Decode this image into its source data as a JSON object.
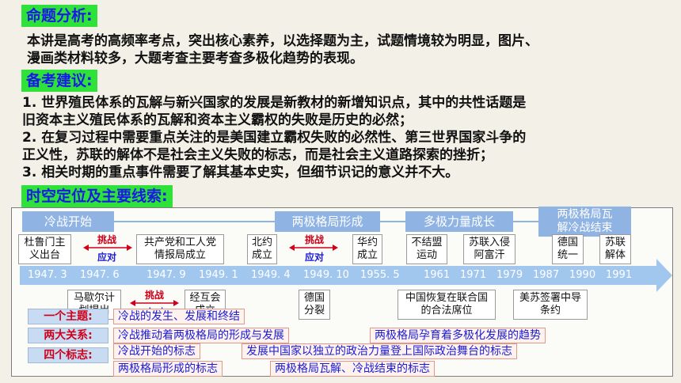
{
  "headings": {
    "analysis": "命题分析:",
    "advice": "备考建议:",
    "timeline": "时空定位及主要线索:"
  },
  "analysis_lines": [
    "本讲是高考的高频率考点，突出核心素养，以选择题为主，试题情境较为明显，图片、",
    "漫画类材料较多，大题考查主要考查多极化趋势的表现。"
  ],
  "advice_lines": [
    "1. 世界殖民体系的瓦解与新兴国家的发展是新教材的新增知识点，其中的共性话题是",
    "旧资本主义殖民体系的瓦解和资本主义霸权的失败是历史的必然；",
    "2. 在复习过程中需要重点关注的是美国建立霸权失败的必然性、第三世界国家斗争的",
    "正义性，苏联的解体不是社会主义失败的标志，而是社会主义道路探索的挫折；",
    "3. 相关时期的重点事件需要了解其基本史实，但细节识记的意义并不大。"
  ],
  "phases": {
    "start": "冷战开始",
    "bipolar": "两极格局形成",
    "multipolar": "多极力量成长",
    "end_line1": "两极格局瓦",
    "end_line2": "解冷战结束"
  },
  "top_events": [
    "杜鲁门主义出台",
    "共产党和工人党情报局成立",
    "北约成立",
    "华约成立",
    "不结盟运动",
    "苏联入侵阿富汗",
    "德国统一",
    "苏联解体"
  ],
  "tags": {
    "challenge": "挑战",
    "respond": "应对"
  },
  "years": [
    "1947. 3",
    "1947. 6",
    "1947. 9",
    "1949. 1",
    "1949. 4",
    "1949. 10",
    "1955. 5",
    "1961",
    "1971",
    "1979",
    "1987",
    "1990",
    "1991"
  ],
  "bottom_events": [
    "马歇尔计划提出",
    "经互会成立",
    "德国分裂",
    "中国恢复在联合国的合法席位",
    "美苏签署中导条约"
  ],
  "summary": {
    "theme_label": "一个主题:",
    "theme": "冷战的发生、发展和终结",
    "relations_label": "两大关系:",
    "relation1": "冷战推动着两极格局的形成与发展",
    "relation2": "两极格局孕育着多极化发展的趋势",
    "marks_label": "四个标志:",
    "mark1": "冷战开始的标志",
    "mark2": "发展中国家以独立的政治力量登上国际政治舞台的标志",
    "mark3": "两极格局形成的标志",
    "mark4": "两极格局瓦解、冷战结束的标志"
  },
  "colors": {
    "heading_bg": "#2ee23a",
    "heading_text": "#1a1ae6",
    "phase_bg": "#8fb4e3",
    "axis_bg": "#a2c7ee",
    "tag_red": "#d0001a",
    "tag_blue": "#1b1bd6"
  }
}
